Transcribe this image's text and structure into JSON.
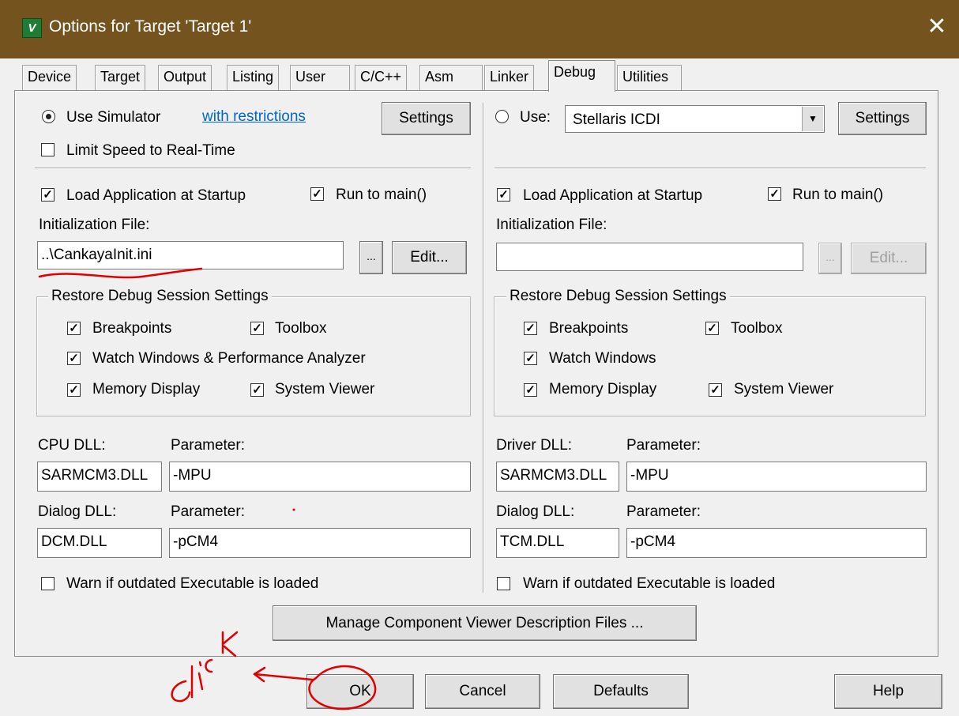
{
  "window": {
    "title": "Options for Target 'Target 1'",
    "app_icon_text": "V",
    "close_glyph": "✕"
  },
  "tabs": [
    {
      "label": "Device"
    },
    {
      "label": "Target"
    },
    {
      "label": "Output"
    },
    {
      "label": "Listing"
    },
    {
      "label": "User"
    },
    {
      "label": "C/C++"
    },
    {
      "label": "Asm"
    },
    {
      "label": "Linker"
    },
    {
      "label": "Debug",
      "active": true
    },
    {
      "label": "Utilities"
    }
  ],
  "left": {
    "use_simulator_label": "Use Simulator",
    "use_simulator_selected": true,
    "restrictions_link": "with restrictions",
    "settings_button": "Settings",
    "limit_speed_label": "Limit Speed to Real-Time",
    "limit_speed_checked": false,
    "load_app_label": "Load Application at Startup",
    "load_app_checked": true,
    "run_to_main_label": "Run to main()",
    "run_to_main_checked": true,
    "init_file_label": "Initialization File:",
    "init_file_value": "..\\CankayaInit.ini",
    "browse_button": "...",
    "edit_button": "Edit...",
    "restore_group_title": "Restore Debug Session Settings",
    "breakpoints_label": "Breakpoints",
    "toolbox_label": "Toolbox",
    "watch_label": "Watch Windows & Performance Analyzer",
    "memory_label": "Memory Display",
    "system_viewer_label": "System Viewer",
    "cpu_dll_label": "CPU DLL:",
    "cpu_dll_value": "SARMCM3.DLL",
    "cpu_param_label": "Parameter:",
    "cpu_param_value": " -MPU",
    "dialog_dll_label": "Dialog DLL:",
    "dialog_dll_value": "DCM.DLL",
    "dialog_param_label": "Parameter:",
    "dialog_param_value": "-pCM4",
    "warn_label": "Warn if outdated Executable is loaded",
    "warn_checked": false
  },
  "right": {
    "use_label": "Use:",
    "use_selected": false,
    "driver_select_value": "Stellaris ICDI",
    "settings_button": "Settings",
    "load_app_label": "Load Application at Startup",
    "load_app_checked": true,
    "run_to_main_label": "Run to main()",
    "run_to_main_checked": true,
    "init_file_label": "Initialization File:",
    "init_file_value": "",
    "browse_button": "...",
    "edit_button": "Edit...",
    "restore_group_title": "Restore Debug Session Settings",
    "breakpoints_label": "Breakpoints",
    "toolbox_label": "Toolbox",
    "watch_label": "Watch Windows",
    "memory_label": "Memory Display",
    "system_viewer_label": "System Viewer",
    "driver_dll_label": "Driver DLL:",
    "driver_dll_value": "SARMCM3.DLL",
    "driver_param_label": "Parameter:",
    "driver_param_value": "-MPU",
    "dialog_dll_label": "Dialog DLL:",
    "dialog_dll_value": "TCM.DLL",
    "dialog_param_label": "Parameter:",
    "dialog_param_value": "-pCM4",
    "warn_label": "Warn if outdated Executable is loaded",
    "warn_checked": false
  },
  "manage_button": "Manage Component Viewer Description Files ...",
  "footer": {
    "ok": "OK",
    "cancel": "Cancel",
    "defaults": "Defaults",
    "help": "Help"
  },
  "annotation": {
    "handwritten_text": "Click",
    "color": "#e00000"
  }
}
